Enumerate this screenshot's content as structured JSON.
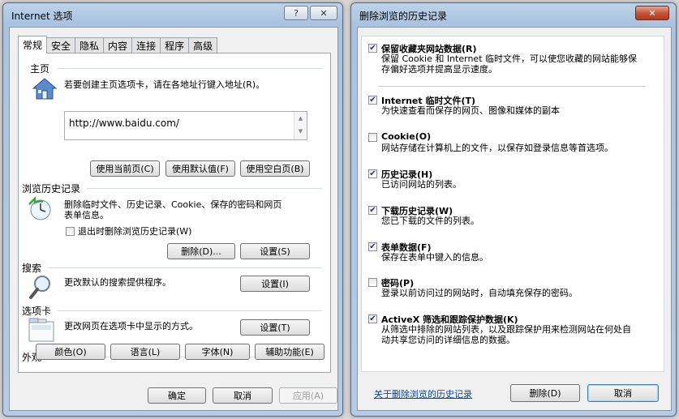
{
  "internet_options": {
    "title": "Internet 选项",
    "help_label": "?",
    "close_label": "✕",
    "tabs": [
      "常规",
      "安全",
      "隐私",
      "内容",
      "连接",
      "程序",
      "高级"
    ],
    "home_page": {
      "header": "主页",
      "description": "若要创建主页选项卡，请在各地址行键入地址(R)。",
      "url": "http://www.baidu.com/",
      "buttons": [
        "使用当前页(C)",
        "使用默认值(F)",
        "使用空白页(B)"
      ]
    },
    "browsing_history": {
      "header": "浏览历史记录",
      "description_line1": "删除临时文件、历史记录、Cookie、保存的密码和网页",
      "description_line2": "表单信息。",
      "checkbox_label": "退出时删除浏览历史记录(W)",
      "checkbox_checked": false,
      "delete_label": "删除(D)...",
      "settings_label": "设置(S)"
    },
    "search": {
      "header": "搜索",
      "description": "更改默认的搜索提供程序。",
      "settings_label": "设置(I)"
    },
    "tabs_section": {
      "header": "选项卡",
      "description": "更改网页在选项卡中显示的方式。",
      "settings_label": "设置(T)"
    },
    "appearance": {
      "header": "外观",
      "buttons": [
        "颜色(O)",
        "语言(L)",
        "字体(N)",
        "辅助功能(E)"
      ]
    },
    "footer": {
      "ok": "确定",
      "cancel": "取消",
      "apply": "应用(A)"
    }
  },
  "delete_history": {
    "title": "删除浏览的历史记录",
    "close_label": "✕",
    "items": [
      {
        "title": "保留收藏夹网站数据(R)",
        "desc": [
          "保留 Cookie 和 Internet 临时文件，可以使您收藏的网站能够保",
          "存偏好选项并提高显示速度。"
        ],
        "checked": true
      },
      {
        "title": "Internet 临时文件(T)",
        "desc": [
          "为快速查看而保存的网页、图像和媒体的副本"
        ],
        "checked": true
      },
      {
        "title": "Cookie(O)",
        "desc": [
          "网站存储在计算机上的文件，以保存如登录信息等首选项。"
        ],
        "checked": false
      },
      {
        "title": "历史记录(H)",
        "desc": [
          "已访问网站的列表。"
        ],
        "checked": true
      },
      {
        "title": "下载历史记录(W)",
        "desc": [
          "您已下载的文件的列表。"
        ],
        "checked": true
      },
      {
        "title": "表单数据(F)",
        "desc": [
          "保存在表单中键入的信息。"
        ],
        "checked": true
      },
      {
        "title": "密码(P)",
        "desc": [
          "登录以前访问过的网站时，自动填充保存的密码。"
        ],
        "checked": false
      },
      {
        "title": "ActiveX 筛选和跟踪保护数据(K)",
        "desc": [
          "从筛选中排除的网站列表，以及跟踪保护用来检测网站在何处自",
          "动共享您访问的详细信息的数据。"
        ],
        "checked": true
      }
    ],
    "link": "关于删除浏览的历史记录",
    "delete_label": "删除(D)",
    "cancel_label": "取消"
  }
}
